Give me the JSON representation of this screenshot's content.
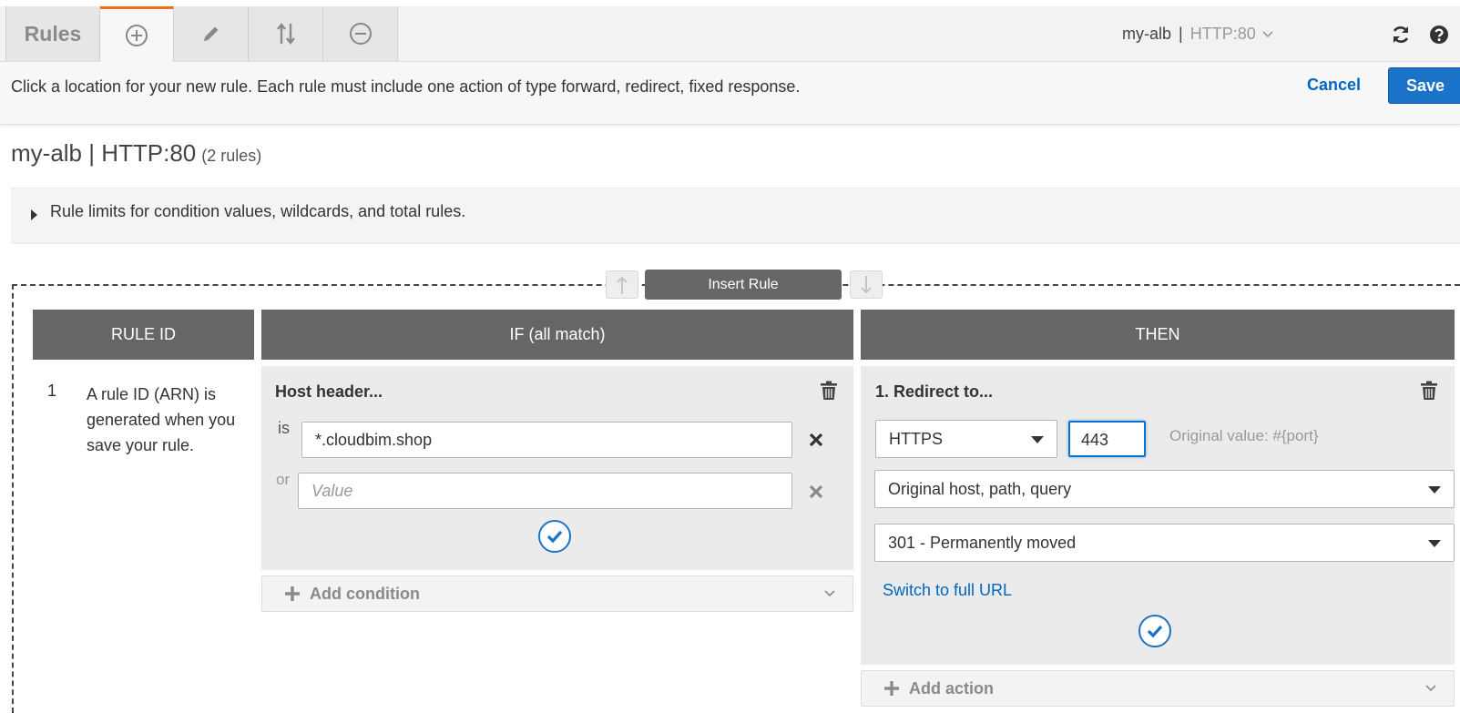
{
  "toolbar": {
    "rules_label": "Rules",
    "listener_name": "my-alb",
    "separator": "|",
    "listener_port": "HTTP:80"
  },
  "message": {
    "text": "Click a location for your new rule. Each rule must include one action of type forward, redirect, fixed response.",
    "cancel_label": "Cancel",
    "save_label": "Save"
  },
  "page": {
    "title": "my-alb | HTTP:80",
    "rule_count": "(2 rules)"
  },
  "limits": {
    "text": "Rule limits for condition values, wildcards, and total rules."
  },
  "insert": {
    "label": "Insert Rule"
  },
  "columns": {
    "rule_id": "RULE ID",
    "if": "IF (all match)",
    "then": "THEN"
  },
  "rule": {
    "number": "1",
    "description": "A rule ID (ARN) is generated when you save your rule."
  },
  "condition": {
    "title": "Host header...",
    "is_label": "is",
    "value": "*.cloudbim.shop",
    "or_label": "or",
    "placeholder": "Value",
    "add_label": "Add condition"
  },
  "action": {
    "title": "1. Redirect to...",
    "protocol": "HTTPS",
    "port": "443",
    "original_port_note": "Original value: #{port}",
    "host_path_query": "Original host, path, query",
    "status_code": "301 - Permanently moved",
    "switch_link": "Switch to full URL",
    "add_label": "Add action"
  },
  "colors": {
    "accent_tab": "#ec7211",
    "primary": "#1a73c9",
    "link": "#0066c0",
    "header_bg": "#666666"
  },
  "icons": [
    "plus-circle-icon",
    "pencil-icon",
    "sort-arrows-icon",
    "minus-circle-icon",
    "refresh-icon",
    "help-icon",
    "trash-icon",
    "close-icon",
    "check-icon",
    "arrow-up-icon",
    "arrow-down-icon",
    "chevron-down-icon",
    "plus-icon"
  ]
}
